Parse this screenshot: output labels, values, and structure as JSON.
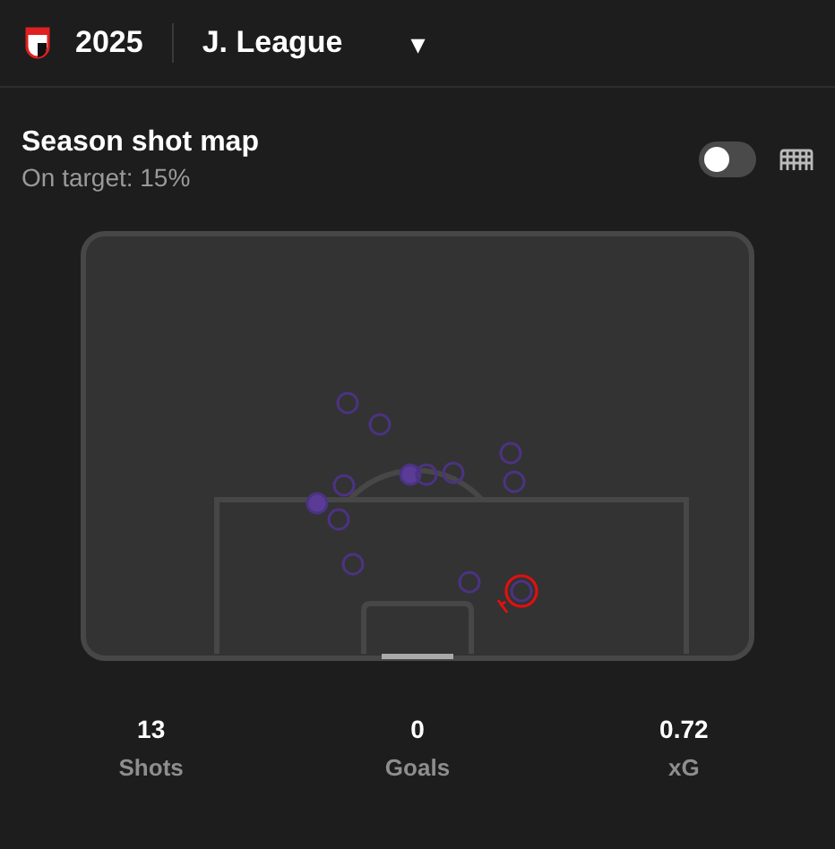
{
  "header": {
    "season": "2025",
    "league": "J. League",
    "dropdown_caret": "▾"
  },
  "shot_map": {
    "title": "Season shot map",
    "subtitle": "On target: 15%",
    "toggle": {
      "on": false
    },
    "shots": [
      {
        "on_target": false,
        "selected": false
      },
      {
        "on_target": false,
        "selected": false
      },
      {
        "on_target": true,
        "selected": false
      },
      {
        "on_target": false,
        "selected": false
      },
      {
        "on_target": false,
        "selected": false
      },
      {
        "on_target": false,
        "selected": false
      },
      {
        "on_target": false,
        "selected": false
      },
      {
        "on_target": false,
        "selected": false
      },
      {
        "on_target": true,
        "selected": false
      },
      {
        "on_target": false,
        "selected": false
      },
      {
        "on_target": false,
        "selected": false
      },
      {
        "on_target": false,
        "selected": false
      },
      {
        "on_target": false,
        "selected": true
      }
    ]
  },
  "stats": [
    {
      "value": "13",
      "label": "Shots"
    },
    {
      "value": "0",
      "label": "Goals"
    },
    {
      "value": "0.72",
      "label": "xG"
    }
  ]
}
